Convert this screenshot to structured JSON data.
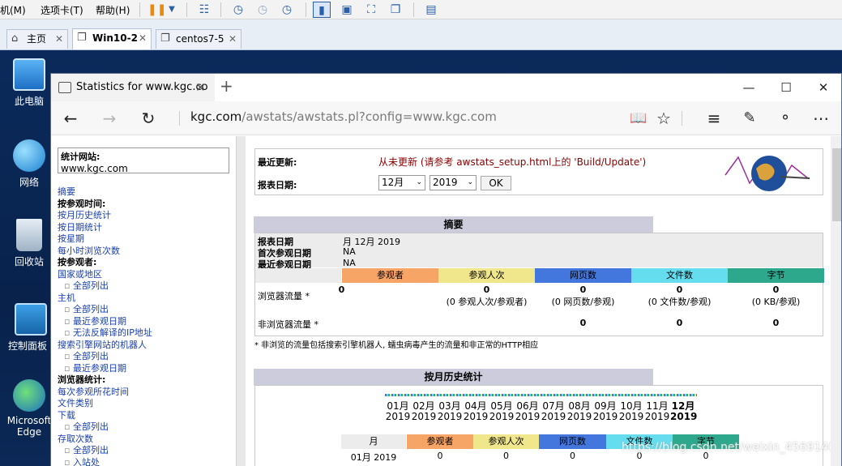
{
  "vm": {
    "menu": [
      "机(M)",
      "选项卡(T)",
      "帮助(H)"
    ],
    "tabs": [
      {
        "label": "主页",
        "active": false
      },
      {
        "label": "Win10-2",
        "active": true
      },
      {
        "label": "centos7-5",
        "active": false
      }
    ]
  },
  "desktop": {
    "icons": [
      "此电脑",
      "网络",
      "回收站",
      "控制面板",
      "Microsoft Edge"
    ]
  },
  "edge": {
    "tab_title": "Statistics for www.kgc.co",
    "url_domain": "kgc.com",
    "url_path": "/awstats/awstats.pl?config=www.kgc.com"
  },
  "left": {
    "site_label": "统计网站:",
    "site_value": "www.kgc.com",
    "nav": [
      {
        "t": "a",
        "text": "摘要"
      },
      {
        "t": "h",
        "text": "按参观时间:"
      },
      {
        "t": "a",
        "text": "按月历史统计"
      },
      {
        "t": "a",
        "text": "按日期统计"
      },
      {
        "t": "a",
        "text": "按星期"
      },
      {
        "t": "a",
        "text": "每小时浏览次数"
      },
      {
        "t": "h",
        "text": "按参观者:"
      },
      {
        "t": "a",
        "text": "国家或地区"
      },
      {
        "t": "sub",
        "text": "全部列出"
      },
      {
        "t": "a",
        "text": "主机"
      },
      {
        "t": "sub",
        "text": "全部列出"
      },
      {
        "t": "sub",
        "text": "最近参观日期"
      },
      {
        "t": "sub",
        "text": "无法反解译的IP地址"
      },
      {
        "t": "a",
        "text": "搜索引擎网站的机器人"
      },
      {
        "t": "sub",
        "text": "全部列出"
      },
      {
        "t": "sub",
        "text": "最近参观日期"
      },
      {
        "t": "h",
        "text": "浏览器统计:"
      },
      {
        "t": "a",
        "text": "每次参观所花时间"
      },
      {
        "t": "a",
        "text": "文件类别"
      },
      {
        "t": "a",
        "text": "下载"
      },
      {
        "t": "sub",
        "text": "全部列出"
      },
      {
        "t": "a",
        "text": "存取次数"
      },
      {
        "t": "sub",
        "text": "全部列出"
      },
      {
        "t": "sub",
        "text": "入站处"
      }
    ]
  },
  "top": {
    "last_update_label": "最近更新:",
    "last_update_value": "从未更新 (请参考 awstats_setup.html上的 'Build/Update')",
    "report_date_label": "报表日期:",
    "month": "12月",
    "year": "2019",
    "ok": "OK"
  },
  "summary": {
    "title": "摘要",
    "rows": [
      {
        "k": "报表日期",
        "v": "月 12月 2019"
      },
      {
        "k": "首次参观日期",
        "v": "NA"
      },
      {
        "k": "最近参观日期",
        "v": "NA"
      }
    ],
    "cols": [
      {
        "label": "参观者",
        "color": "#f7a566"
      },
      {
        "label": "参观人次",
        "color": "#f0e68c"
      },
      {
        "label": "网页数",
        "color": "#4477dd"
      },
      {
        "label": "文件数",
        "color": "#66ddee"
      },
      {
        "label": "字节",
        "color": "#2ea88d"
      }
    ],
    "browser_label": "浏览器流量 *",
    "browser_vals": [
      "0",
      "0",
      "0",
      "0",
      "0"
    ],
    "browser_sub": [
      "",
      "(0 参观人次/参观者)",
      "(0 网页数/参观)",
      "(0 文件数/参观)",
      "(0 KB/参观)"
    ],
    "nonbrowser_label": "非浏览器流量 *",
    "nonbrowser_vals": [
      "",
      "",
      "0",
      "0",
      "0"
    ],
    "note": "* 非浏览的流量包括搜索引擎机器人, 蠕虫病毒产生的流量和非正常的HTTP相应"
  },
  "monthly": {
    "title": "按月历史统计",
    "months": [
      "01月",
      "02月",
      "03月",
      "04月",
      "05月",
      "06月",
      "07月",
      "08月",
      "09月",
      "10月",
      "11月",
      "12月"
    ],
    "year": "2019",
    "table_cols": [
      "月",
      "参观者",
      "参观人次",
      "网页数",
      "文件数",
      "字节"
    ],
    "first_row": [
      "01月 2019",
      "0",
      "0",
      "0",
      "0",
      "0"
    ]
  },
  "watermark": "https://blog.csdn.net/weixin_45691464"
}
